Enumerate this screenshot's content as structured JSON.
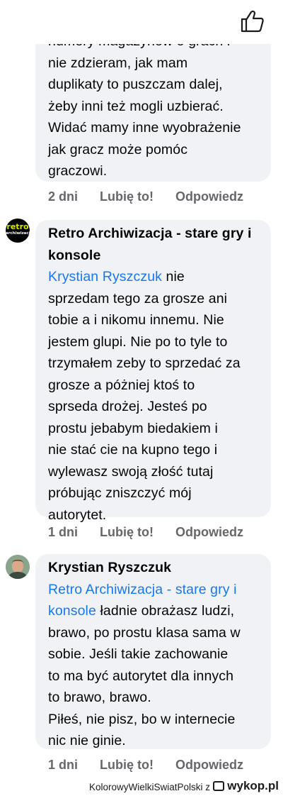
{
  "comments": [
    {
      "lines": [
        "numery magazynów o grach i",
        "nie zdzieram, jak mam",
        "duplikaty to puszczam dalej,",
        "żeby inni też mogli uzbierać.",
        "Widać mamy inne wyobrażenie",
        "jak gracz może pomóc",
        "graczowi."
      ],
      "actions": {
        "time": "2 dni",
        "like": "Lubię to!",
        "reply": "Odpowiedz"
      }
    },
    {
      "author": "Retro Archiwizacja - stare gry i konsole",
      "author_lines": [
        "Retro Archiwizacja - stare gry i",
        "konsole"
      ],
      "avatar_text": {
        "top": "retro",
        "bottom": "archiwizacja"
      },
      "mention": "Krystian Ryszczuk",
      "lines": [
        " nie",
        "sprzedam tego za grosze ani",
        "tobie a i nikomu innemu. Nie",
        "jestem glupi. Nie po to tyle to",
        "trzymałem zeby to sprzedać za",
        "grosze a póżniej ktoś to",
        "sprseda drożej. Jesteś po",
        "prostu jebabym biedakiem i",
        "nie stać cie na kupno tego i",
        "wylewasz swoją złość tutaj",
        "próbując zniszczyć mój",
        "autorytet."
      ],
      "actions": {
        "time": "1 dni",
        "like": "Lubię to!",
        "reply": "Odpowiedz"
      }
    },
    {
      "author": "Krystian Ryszczuk",
      "mention_lines": [
        "Retro Archiwizacja - stare gry i",
        "konsole"
      ],
      "lines": [
        " ładnie obrażasz ludzi,",
        "brawo, po prostu klasa sama w",
        "sobie. Jeśli takie zachowanie",
        "to ma być autorytet dla innych",
        "to brawo, brawo.",
        "Piłeś, nie pisz, bo w internecie",
        "nic nie ginie."
      ],
      "actions": {
        "time": "1 dni",
        "like": "Lubię to!",
        "reply": "Odpowiedz"
      }
    }
  ],
  "footer": {
    "user": "KolorowyWielkiSwiatPolski",
    "connector": "z",
    "site": "wykop.pl"
  },
  "colors": {
    "bubble": "#f0f2f5",
    "link": "#1877f2",
    "meta": "#65676b"
  }
}
